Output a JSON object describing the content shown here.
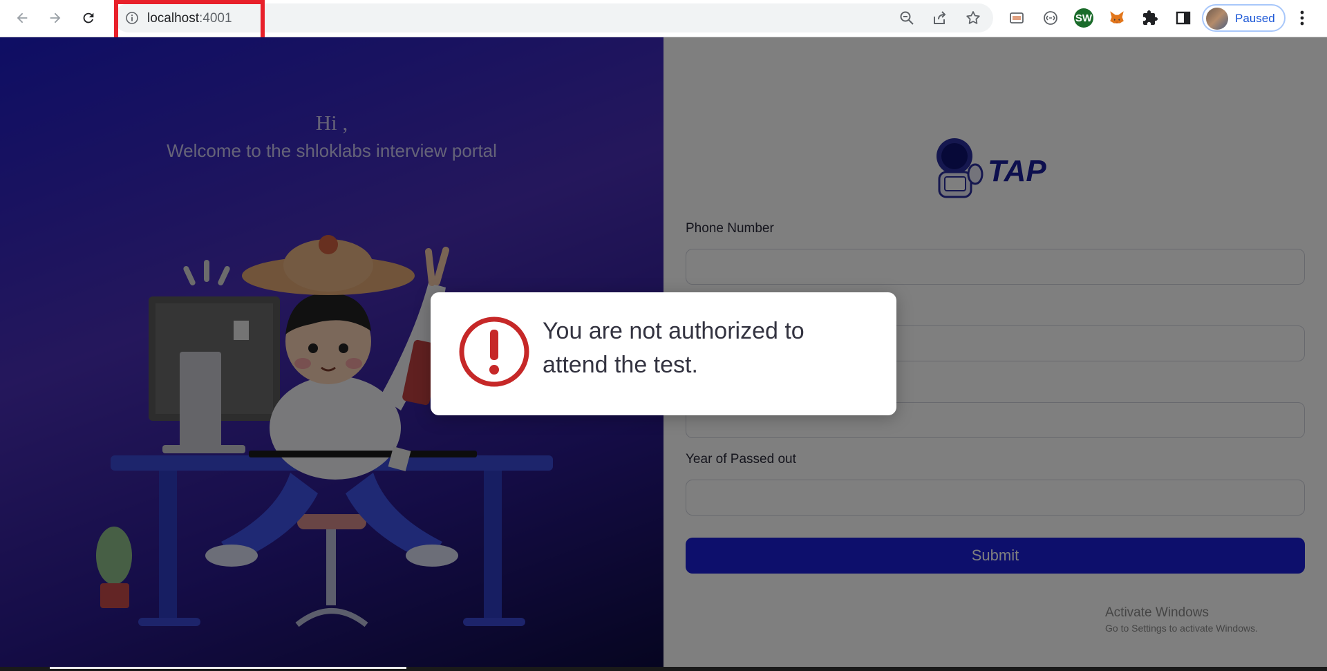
{
  "browser": {
    "url_host": "localhost",
    "url_port": ":4001",
    "profile_status": "Paused",
    "extensions": [
      "cast-icon",
      "vpn-icon",
      "sw-extension-icon",
      "metamask-fox-icon",
      "puzzle-extensions-icon",
      "side-panel-icon"
    ],
    "sw_label": "SW"
  },
  "left": {
    "greeting": "Hi ,",
    "welcome": "Welcome to the shloklabs interview portal"
  },
  "form": {
    "logo_text": "TAP",
    "fields": [
      {
        "label": "Phone Number",
        "value": ""
      },
      {
        "label": "",
        "value": ""
      },
      {
        "label": "",
        "value": ""
      },
      {
        "label": "Year of Passed out",
        "value": ""
      }
    ],
    "submit_label": "Submit"
  },
  "dialog": {
    "message": "You are not authorized to attend the test."
  },
  "watermark": {
    "title": "Activate Windows",
    "subtitle": "Go to Settings to activate Windows."
  },
  "colors": {
    "accent": "#1a1fd8",
    "error": "#c62828",
    "highlight": "#e8202a"
  }
}
